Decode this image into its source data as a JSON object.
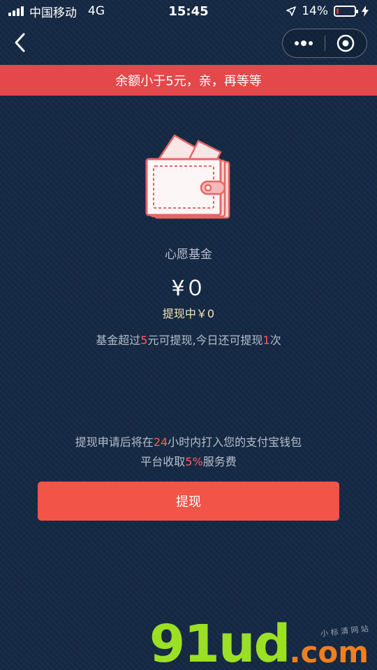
{
  "status_bar": {
    "carrier": "中国移动",
    "network": "4G",
    "time": "15:45",
    "battery": "14%",
    "battery_level": 0.14,
    "battery_color": "#e53935"
  },
  "nav": {
    "back_icon": "chevron-left-icon",
    "menu_icon": "more-dots-icon",
    "close_icon": "target-circle-icon"
  },
  "banner": {
    "text": "余额小于5元，亲，再等等",
    "color": "#e4484a"
  },
  "fund": {
    "icon": "wallet-icon",
    "title": "心愿基金",
    "amount": "¥０",
    "withdrawing": "提现中￥0",
    "note_prefix": "基金超过",
    "note_min": "5",
    "note_middle": "元可提现,今日还可提现",
    "note_times": "1",
    "note_suffix": "次"
  },
  "info": {
    "line1_prefix": "提现申请后将在",
    "line1_hours": "24",
    "line1_suffix": "小时内打入您的支付宝钱包",
    "line2_prefix": "平台收取",
    "line2_fee": "5%",
    "line2_suffix": "服务费"
  },
  "withdraw_button": {
    "label": "提现",
    "color": "#f25448"
  },
  "watermark": {
    "main": "91ud",
    "dot": ".com",
    "sub": "小 标 清 网 站"
  }
}
